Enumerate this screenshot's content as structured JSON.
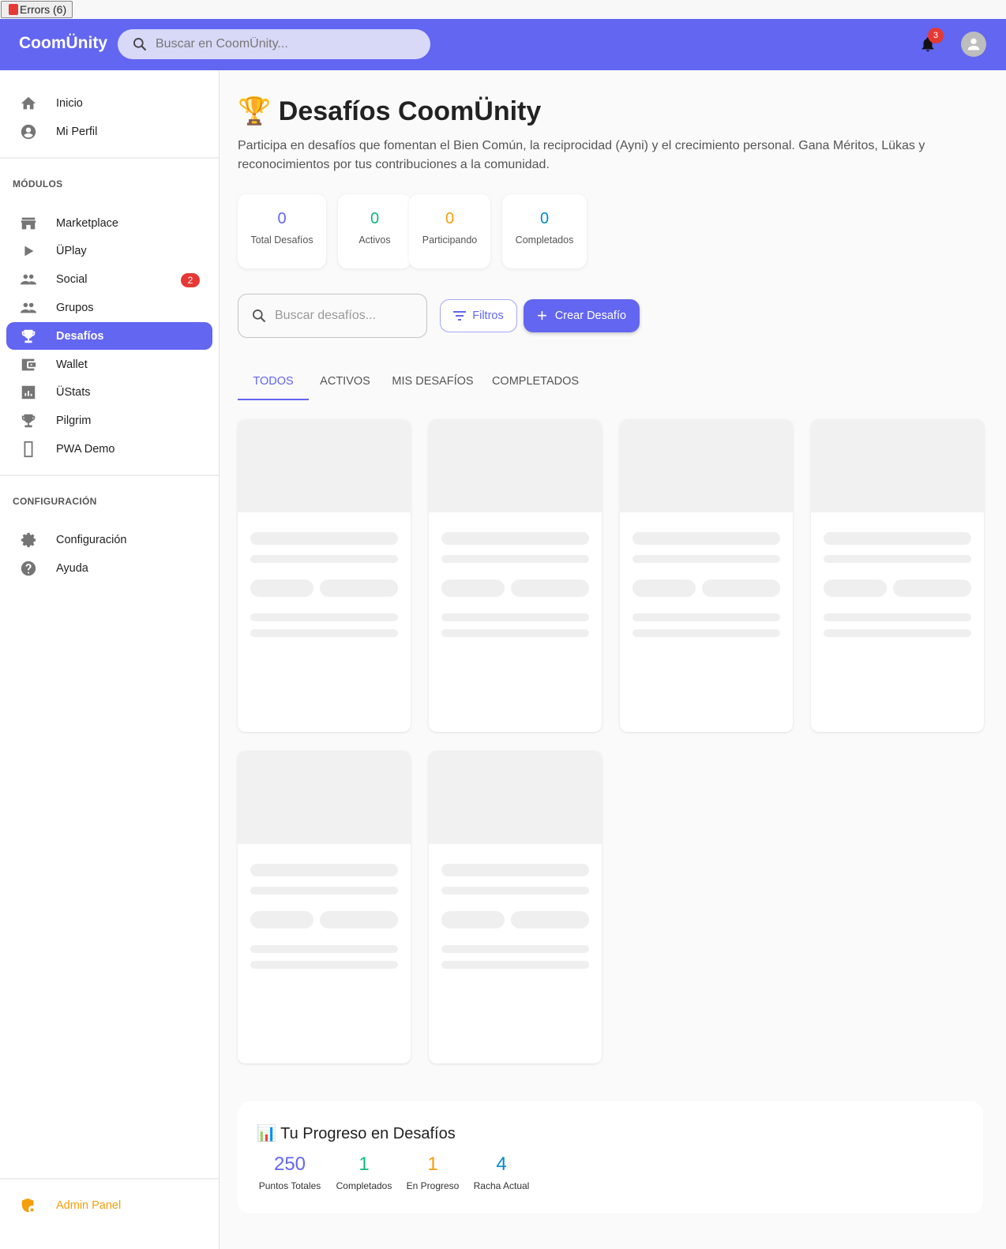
{
  "devtools": {
    "errors_label": "Errors (6)"
  },
  "header": {
    "logo": "CoomÜnity",
    "search_placeholder": "Buscar en CoomÜnity...",
    "notification_count": "3",
    "brand_color": "#6366f1"
  },
  "sidebar": {
    "top_items": [
      {
        "label": "Inicio",
        "icon": "home-icon"
      },
      {
        "label": "Mi Perfil",
        "icon": "account-circle-icon"
      }
    ],
    "modules_title": "MÓDULOS",
    "modules": [
      {
        "label": "Marketplace",
        "icon": "store-icon"
      },
      {
        "label": "ÜPlay",
        "icon": "play-icon"
      },
      {
        "label": "Social",
        "icon": "people-icon",
        "badge": "2"
      },
      {
        "label": "Grupos",
        "icon": "people-icon"
      },
      {
        "label": "Desafíos",
        "icon": "trophy-icon",
        "active": true
      },
      {
        "label": "Wallet",
        "icon": "wallet-icon"
      },
      {
        "label": "ÜStats",
        "icon": "chart-icon"
      },
      {
        "label": "Pilgrim",
        "icon": "trophy-icon"
      },
      {
        "label": "PWA Demo",
        "icon": "phone-icon"
      }
    ],
    "config_title": "CONFIGURACIÓN",
    "config": [
      {
        "label": "Configuración",
        "icon": "gear-icon"
      },
      {
        "label": "Ayuda",
        "icon": "help-icon"
      }
    ],
    "admin": {
      "label": "Admin Panel",
      "icon": "admin-shield-icon"
    }
  },
  "main": {
    "title_emoji": "🏆",
    "title": "Desafíos CoomÜnity",
    "description": "Participa en desafíos que fomentan el Bien Común, la reciprocidad (Ayni) y el crecimiento personal. Gana Méritos, Lükas y reconocimientos por tus contribuciones a la comunidad.",
    "stats": [
      {
        "value": "0",
        "label": "Total Desafíos",
        "color": "#6366f1"
      },
      {
        "value": "0",
        "label": "Activos",
        "color": "#10b981"
      },
      {
        "value": "0",
        "label": "Participando",
        "color": "#f59e0b"
      },
      {
        "value": "0",
        "label": "Completados",
        "color": "#0288d1"
      }
    ],
    "search_placeholder": "Buscar desafíos...",
    "filters_label": "Filtros",
    "create_label": "Crear Desafío",
    "tabs": [
      {
        "label": "TODOS",
        "active": true
      },
      {
        "label": "ACTIVOS"
      },
      {
        "label": "MIS DESAFÍOS"
      },
      {
        "label": "COMPLETADOS"
      }
    ],
    "progress": {
      "emoji": "📊",
      "title": "Tu Progreso en Desafíos",
      "items": [
        {
          "value": "250",
          "label": "Puntos Totales",
          "color": "#6366f1"
        },
        {
          "value": "1",
          "label": "Completados",
          "color": "#10b981"
        },
        {
          "value": "1",
          "label": "En Progreso",
          "color": "#f59e0b"
        },
        {
          "value": "4",
          "label": "Racha Actual",
          "color": "#0288d1"
        }
      ]
    }
  }
}
